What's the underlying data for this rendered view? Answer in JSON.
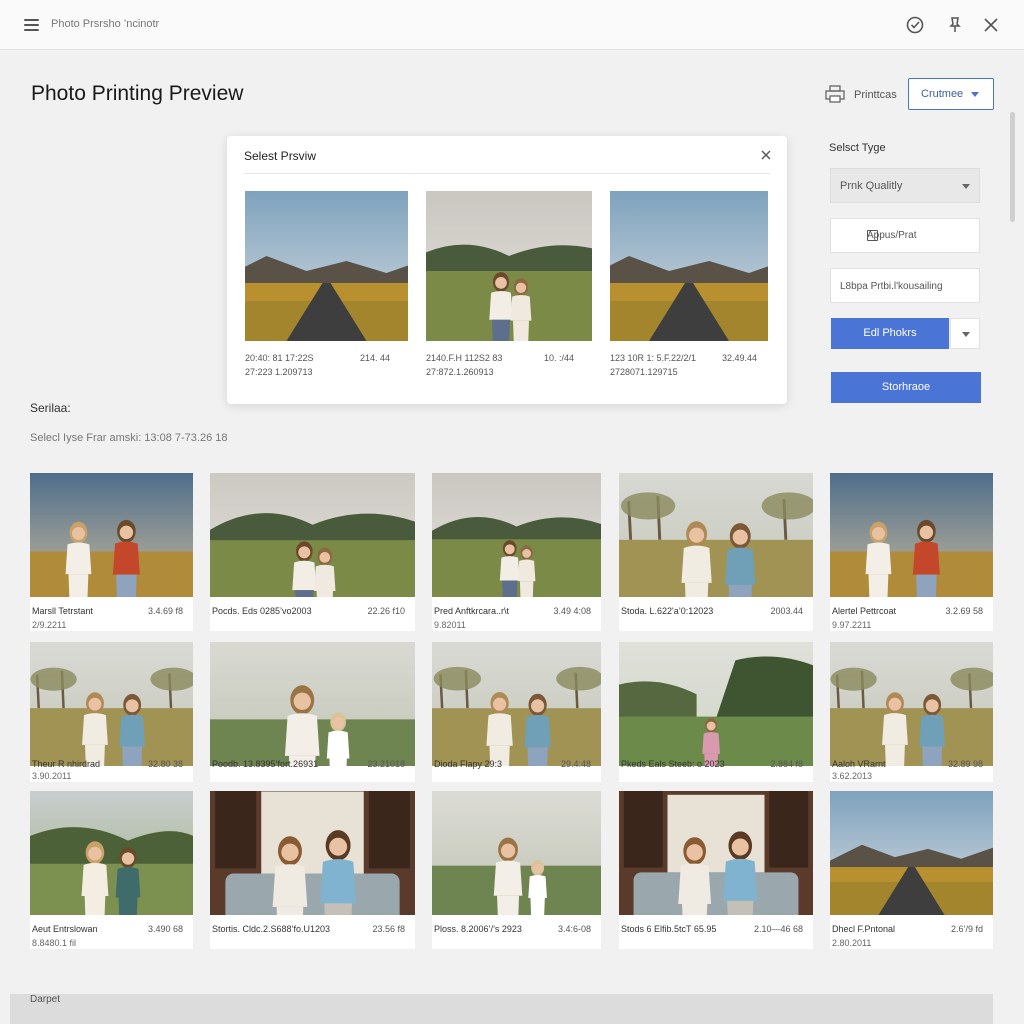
{
  "topbar": {
    "app_title": "Photo Prsrsho ’ncinotr"
  },
  "header": {
    "title": "Photo Printing Preview",
    "prints_label": "Printtcas",
    "continue_label": "Crutmee"
  },
  "modal": {
    "title": "Selest Prsviw",
    "photos": [
      {
        "caption1": "20:40: 81 17:22S",
        "caption2": "27:223 1.209713",
        "size": "214. 44",
        "scene": "road"
      },
      {
        "caption1": "2140.F.H 112S2 83",
        "caption2": "27:872.1.260913",
        "size": "10. :/44",
        "scene": "woman"
      },
      {
        "caption1": "123 10R 1: 5.F.22/2/1",
        "caption2": "2728071.129715",
        "size": "32.49.44",
        "scene": "road"
      }
    ]
  },
  "panel": {
    "select_type_label": "Selsct Tyge",
    "quality_value": "Prnk Qualitly",
    "checkbox_label": "Appus/Prat",
    "text_field_value": "L8bpa Prtbi.l'kousailing",
    "edit_label": "Edl Phokrs",
    "storage_label": "Storhraoe"
  },
  "info": {
    "section_label": "Serilaa:",
    "section_sub": "Selecl Iyse Frar amski: 13:08 7-73.26 18"
  },
  "grid": [
    {
      "title": "Marsll Tetrstant",
      "sub": "2/9.2211",
      "size": "3.4.69 f8",
      "scene": "couple"
    },
    {
      "title": "Pocds. Eds 0285’vo2003",
      "sub": "",
      "size": "22.26 f10",
      "scene": "sitting"
    },
    {
      "title": "Pred Anftkrcara..r\\t",
      "sub": "9.82011",
      "size": "3.49 4:08",
      "scene": "sitting"
    },
    {
      "title": "Stoda. L.622'a’0:12023",
      "sub": "",
      "size": "2003.44",
      "scene": "twofield"
    },
    {
      "title": "Alertel Pettrcoat",
      "sub": "9.97.2211",
      "size": "3.2.69 58",
      "scene": "couple"
    },
    {
      "title": "Theur R nhirdrad",
      "sub": "3.90.2011",
      "size": "32.80 38",
      "scene": "twofield"
    },
    {
      "title": "Poodb. 13.8395’fort.26931",
      "sub": "",
      "size": "23.21018",
      "scene": "mother"
    },
    {
      "title": "Dioda Flapy 29:3",
      "sub": "",
      "size": "29.4:48",
      "scene": "twofield"
    },
    {
      "title": "Pkeds Eals Steeb: o 2023",
      "sub": "",
      "size": "2.884 f8",
      "scene": "child"
    },
    {
      "title": "Aaloh VRarnt",
      "sub": "3.62.2013",
      "size": "32.89 98",
      "scene": "twofield"
    },
    {
      "title": "Aeut Entrslowan",
      "sub": "8.8480.1 fil",
      "size": "3.490 68",
      "scene": "hug"
    },
    {
      "title": "Stortis. Cldc.2.S688’fo.U1203",
      "sub": "",
      "size": "23.56 f8",
      "scene": "sofa"
    },
    {
      "title": "Ploss. 8.2006’/’s 2923",
      "sub": "",
      "size": "3.4:6-08",
      "scene": "mother2"
    },
    {
      "title": "Stods 6 Elfib.5tcT 65.95",
      "sub": "",
      "size": "2.10—46 68",
      "scene": "sofa"
    },
    {
      "title": "Dhecl F.Pntonal",
      "sub": "2.80.2011",
      "size": "2.6’/9 fd",
      "scene": "road"
    }
  ],
  "footer": {
    "label": "Darpet"
  },
  "colors": {
    "accent": "#4a74d6",
    "background": "#f1f1f1"
  }
}
